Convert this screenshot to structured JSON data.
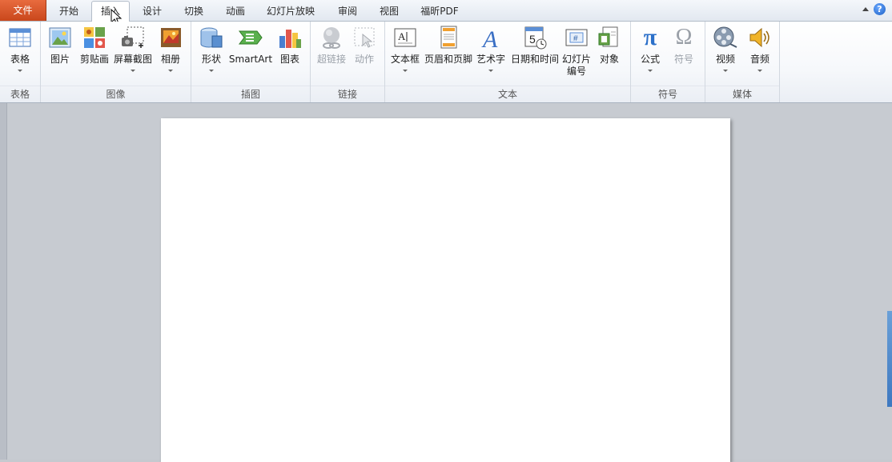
{
  "tabs": {
    "file": "文件",
    "home": "开始",
    "insert": "插入",
    "design": "设计",
    "transitions": "切换",
    "animations": "动画",
    "slideshow": "幻灯片放映",
    "review": "审阅",
    "view": "视图",
    "foxit": "福昕PDF"
  },
  "help_glyph": "?",
  "groups": {
    "tables": {
      "label": "表格",
      "table": "表格"
    },
    "images": {
      "label": "图像",
      "picture": "图片",
      "clipart": "剪贴画",
      "screenshot": "屏幕截图",
      "album": "相册"
    },
    "illustrations": {
      "label": "插图",
      "shapes": "形状",
      "smartart": "SmartArt",
      "chart": "图表"
    },
    "links": {
      "label": "链接",
      "hyperlink": "超链接",
      "action": "动作"
    },
    "text": {
      "label": "文本",
      "textbox": "文本框",
      "headerfooter": "页眉和页脚",
      "wordart": "艺术字",
      "datetime": "日期和时间",
      "slidenum1": "幻灯片",
      "slidenum2": "编号",
      "object": "对象"
    },
    "symbols": {
      "label": "符号",
      "equation": "公式",
      "symbol": "符号"
    },
    "media": {
      "label": "媒体",
      "video": "视频",
      "audio": "音频"
    }
  },
  "icon_glyphs": {
    "pi": "π",
    "omega": "Ω",
    "textbox_a": "A",
    "wordart_a": "A",
    "date_num": "5",
    "hash": "#"
  },
  "colors": {
    "file_tab": "#d4531f",
    "ribbon_bg": "#f6f8fb",
    "workspace": "#c7cbd1",
    "accent": "#2a6fc9"
  }
}
